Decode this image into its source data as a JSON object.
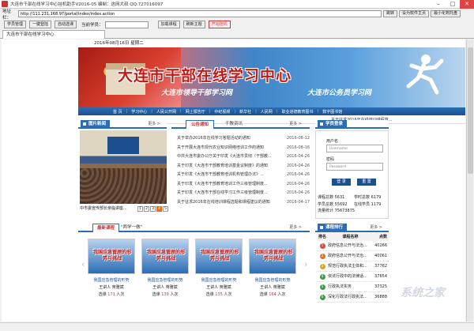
{
  "window": {
    "title": "大连市干部在线学习中心挂机助手V2016-05 编制：这网大叔 QQ:727016097"
  },
  "address": {
    "label": "地址栏：",
    "url": "http://111.231.168.97/portal/index/index.action",
    "buttons": [
      "跳转",
      "设为软件主页",
      "最小化到托盘"
    ]
  },
  "toolbar": {
    "buttons": [
      "学员管理",
      "一键登陆",
      "自动选课"
    ],
    "user_label": "当前学员：",
    "right_buttons": [
      "加载课程",
      "刷新主题",
      "开始挂机"
    ]
  },
  "tab": {
    "label": "大连市干部在线学习中心"
  },
  "site": {
    "date": "2016年08月16日 星期二",
    "title": "大连市干部在线学习中心",
    "sub1": "大连市领导干部学习网",
    "sub2": "大连市公务员学习网",
    "nav": [
      "首 页",
      "学习中心",
      "人民公开网",
      "网上报告厅",
      "中纪视频",
      "新华社",
      "人民网",
      "职业道德教育图书",
      "数字图书馆"
    ],
    "ticker": "关于征求2016年在线培训课程意..."
  },
  "pic_news": {
    "title": "图片新闻",
    "more": "更多 >",
    "caption": "中市委宣传部长亲临讲座...",
    "pages": [
      "1",
      "2",
      "3",
      "4",
      "5"
    ],
    "current_page": 4
  },
  "news": {
    "tab_active": "公告通知",
    "tab_other": "干教资讯",
    "more": "更多 >",
    "items": [
      {
        "title": "关于举办2016年在线学习答题活动的通知",
        "date": "2016-08-12"
      },
      {
        "title": "关于开展大连市现代农业知识网络培训工作的通知",
        "date": "2016-08-16"
      },
      {
        "title": "中共大连市委办公厅关于印发《大连市贯彻〈干部教...",
        "date": "2016-04-26"
      },
      {
        "title": "关于印发《大连市干部教育培训基金议制度》的通知",
        "date": "2016-04-26"
      },
      {
        "title": "关于印发《大连市干部教育培训机构管理办法》...",
        "date": "2016-04-26"
      },
      {
        "title": "关于印发《大连市干部教育培训工作三级管理制度...",
        "date": "2016-04-26"
      },
      {
        "title": "关于印发《大连市干部在线学习工作三级管理制度...",
        "date": "2016-04-26"
      },
      {
        "title": "关于征求2016年在线培训课程选题和课程建议的通知",
        "date": "2016-04-17"
      }
    ]
  },
  "login": {
    "title": "学员登录",
    "username_label": "用户名",
    "username_placeholder": "Username",
    "password_label": "密码",
    "password_placeholder": "Password",
    "login_button": "登 录",
    "reset_button": "重 置",
    "stats": [
      [
        "课程总数",
        "5631",
        "学时总数",
        "6179"
      ],
      [
        "学员总数",
        "55692",
        "在线学员",
        "1179"
      ],
      [
        "流量统计",
        "75673875",
        "",
        ""
      ]
    ]
  },
  "courses": {
    "tab_active": "最新课程",
    "tab_other": "\"两学一做\"",
    "more": "更多 >",
    "items": [
      {
        "thumb": "我国应急管理的形势与挑战",
        "name": "我国应急管理的形势",
        "teacher": "王讲人  蒋雅斌",
        "views": "171",
        "views_prefix": "选课",
        "views_suffix": "人次"
      },
      {
        "thumb": "我国应急管理的形势与挑战",
        "name": "我国应急管理的形势",
        "teacher": "王讲人  蒋雅斌",
        "views": "139",
        "views_prefix": "选课",
        "views_suffix": "人次"
      },
      {
        "thumb": "我国应急管理的形势与挑战",
        "name": "我国应急管理的形势",
        "teacher": "王讲人  蒋雅斌",
        "views": "135",
        "views_prefix": "选课",
        "views_suffix": "人次"
      },
      {
        "thumb": "我国应急管理的形势与挑战",
        "name": "我国应急管理的形势",
        "teacher": "王讲人  蒋雅斌",
        "views": "164",
        "views_prefix": "选课",
        "views_suffix": "人次"
      }
    ]
  },
  "ranking": {
    "title": "课程排行",
    "more": "更多 >",
    "headers": [
      "排名",
      "课程名称",
      "点数"
    ],
    "rows": [
      {
        "rank": "1",
        "name": "政府信息公开与法治...",
        "count": "40266",
        "color": "#e04343"
      },
      {
        "rank": "2",
        "name": "政府信息公开与法治...",
        "count": "40061",
        "color": "#e07020"
      },
      {
        "rank": "3",
        "name": "规范行政执法主体和...",
        "count": "37762",
        "color": "#e0a020"
      },
      {
        "rank": "4",
        "name": "依法行政中的法律适...",
        "count": "37654",
        "color": "#3a9a4a"
      },
      {
        "rank": "5",
        "name": "行政执法实务",
        "count": "37325",
        "color": "#3a9a4a"
      },
      {
        "rank": "6",
        "name": "深化行政法行政执法...",
        "count": "36888",
        "color": "#3a9a4a"
      }
    ]
  },
  "watermark": "系统之家"
}
